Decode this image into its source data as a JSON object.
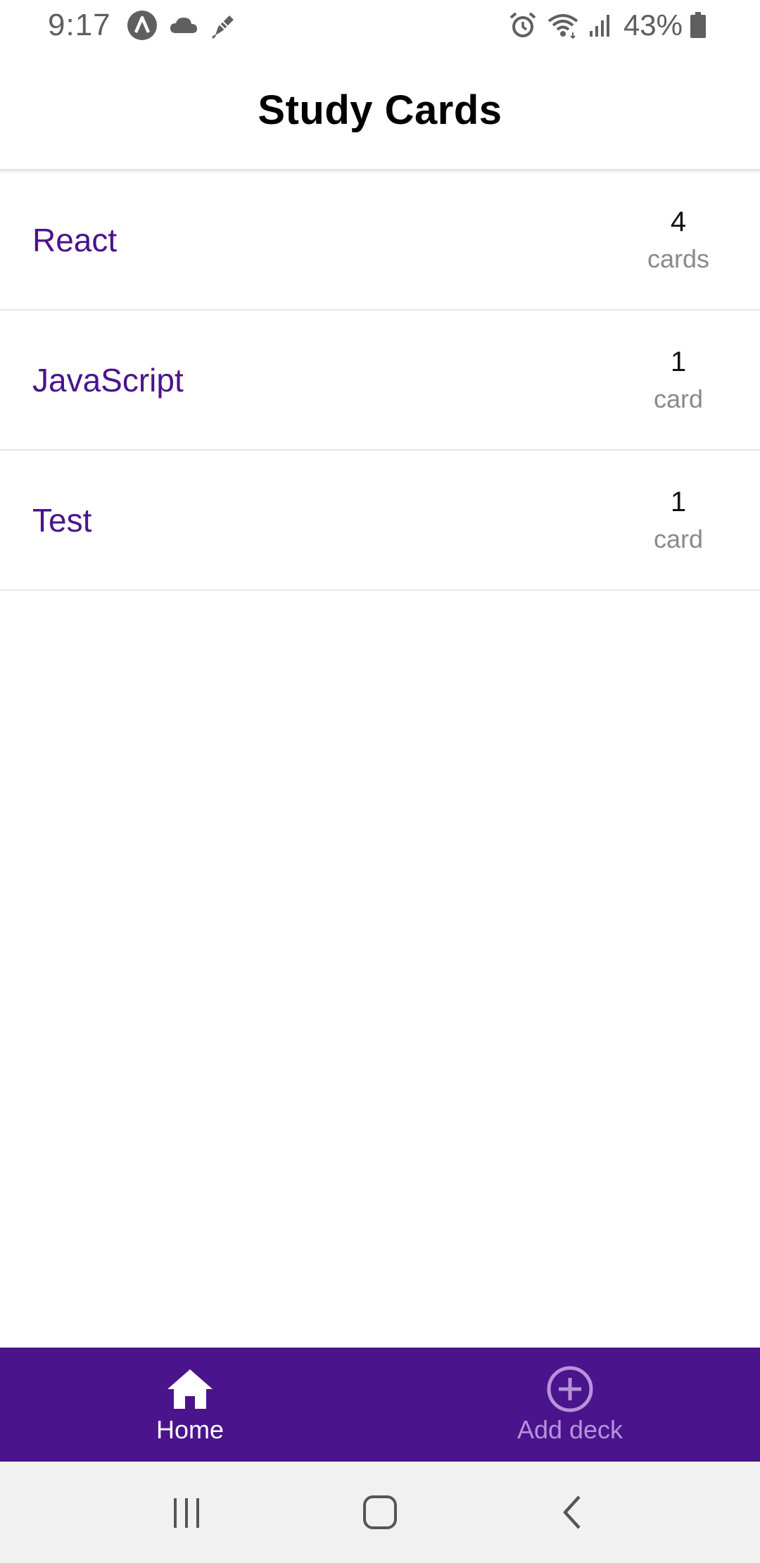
{
  "status_bar": {
    "time": "9:17",
    "left_icons": [
      "android-auto-icon",
      "cloud-icon",
      "notification-pen-icon"
    ],
    "right_icons": [
      "alarm-icon",
      "wifi-icon",
      "signal-icon",
      "battery-icon"
    ],
    "battery_percent": "43%"
  },
  "header": {
    "title": "Study Cards"
  },
  "decks": [
    {
      "name": "React",
      "count": "4",
      "unit": "cards"
    },
    {
      "name": "JavaScript",
      "count": "1",
      "unit": "card"
    },
    {
      "name": "Test",
      "count": "1",
      "unit": "card"
    }
  ],
  "tabs": [
    {
      "label": "Home",
      "icon": "home-icon",
      "active": true
    },
    {
      "label": "Add deck",
      "icon": "add-circle-icon",
      "active": false
    }
  ],
  "nav_bar": {
    "buttons": [
      "recents-icon",
      "home-button-icon",
      "back-icon"
    ]
  },
  "colors": {
    "accent": "#4a148c",
    "tab_inactive": "#b792dc",
    "nav_bg": "#f1f1f1"
  }
}
